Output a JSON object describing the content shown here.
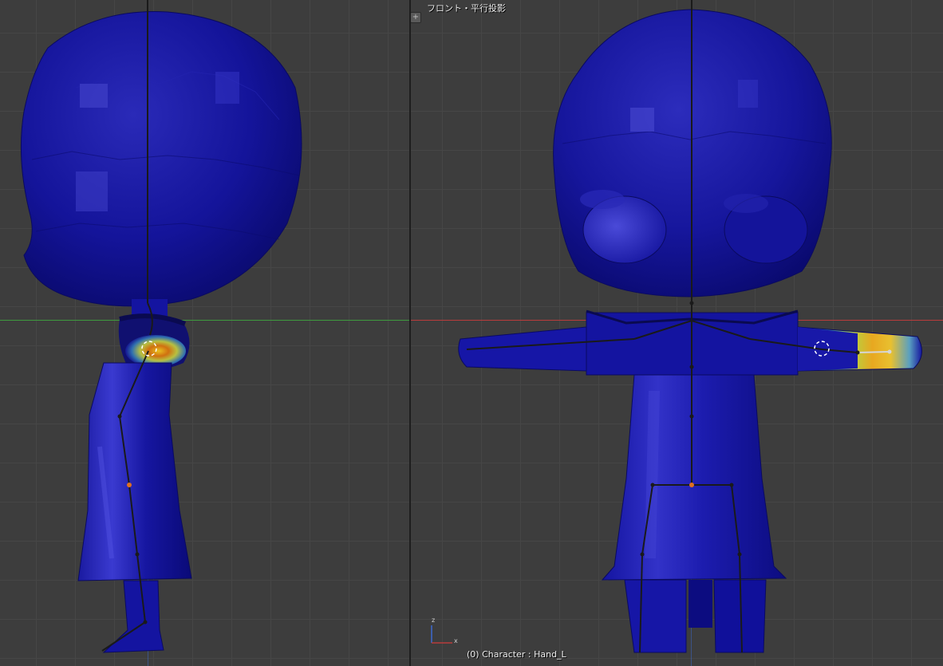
{
  "viewport_front": {
    "view_label": "フロント・平行投影",
    "status_text": "(0) Character : Hand_L",
    "gizmo": {
      "x_label": "x",
      "z_label": "z"
    },
    "x_axis_color": "#b83c3c",
    "z_axis_color": "#3c6ad0"
  },
  "viewport_side": {
    "y_axis_color": "#3f9a3f",
    "z_axis_color": "#3c6ad0"
  },
  "split_handles": [
    "+",
    "+"
  ],
  "colors": {
    "weight_zero": "#0f0f8c",
    "weight_low": "#2e9ad6",
    "weight_mid": "#c8d33a",
    "weight_high": "#e85a10",
    "bone_line": "#1a1a1a",
    "active_bone": "#d6d6d6",
    "joint_selected": "#e07020"
  }
}
